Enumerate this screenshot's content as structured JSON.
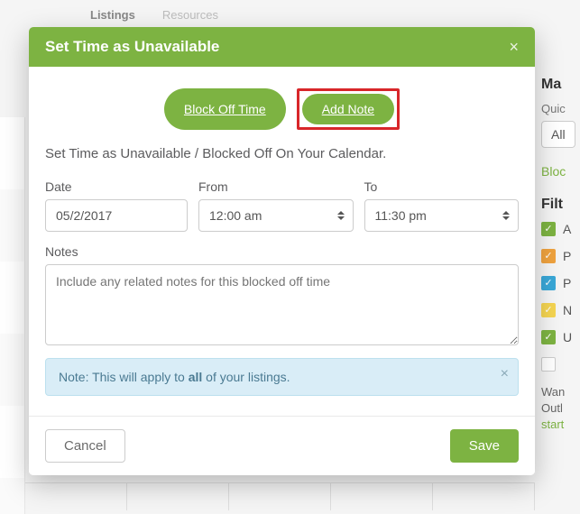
{
  "background": {
    "nav": {
      "listings": "Listings",
      "resources": "Resources"
    },
    "sidebar_right": {
      "heading1_partial": "Ma",
      "quick_label_partial": "Quic",
      "all_button_partial": "All",
      "block_link_partial": "Bloc",
      "filter_heading_partial": "Filt",
      "items": [
        {
          "color": "c-green",
          "label": "A"
        },
        {
          "color": "c-orange",
          "label": "P"
        },
        {
          "color": "c-blue",
          "label": "P"
        },
        {
          "color": "c-yellow",
          "label": "N"
        },
        {
          "color": "c-green2",
          "label": "U"
        },
        {
          "color": "c-gray",
          "label": ""
        }
      ],
      "want_line1": "Wan",
      "want_line2": "Outl",
      "want_link": "start"
    }
  },
  "modal": {
    "title": "Set Time as Unavailable",
    "tabs": {
      "block_off": "Block Off Time",
      "add_note": "Add Note"
    },
    "intro": "Set Time as Unavailable / Blocked Off On Your Calendar.",
    "fields": {
      "date_label": "Date",
      "date_value": "05/2/2017",
      "from_label": "From",
      "from_value": "12:00 am",
      "to_label": "To",
      "to_value": "11:30 pm",
      "notes_label": "Notes",
      "notes_placeholder": "Include any related notes for this blocked off time"
    },
    "alert": {
      "prefix": "Note: This will apply to ",
      "bold": "all",
      "suffix": " of your listings."
    },
    "buttons": {
      "cancel": "Cancel",
      "save": "Save"
    }
  }
}
